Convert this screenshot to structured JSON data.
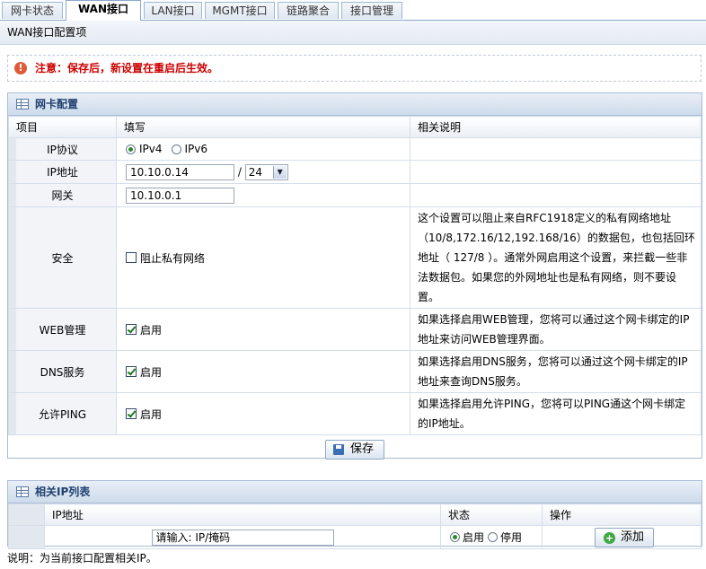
{
  "tabs": [
    {
      "label": "网卡状态",
      "active": false
    },
    {
      "label": "WAN接口",
      "active": true
    },
    {
      "label": "LAN接口",
      "active": false
    },
    {
      "label": "MGMT接口",
      "active": false
    },
    {
      "label": "链路聚合",
      "active": false
    },
    {
      "label": "接口管理",
      "active": false
    }
  ],
  "subheader": "WAN接口配置项",
  "notice": "注意：保存后，新设置在重启后生效。",
  "nic_panel": {
    "title": "网卡配置",
    "columns": [
      "项目",
      "填写",
      "相关说明"
    ],
    "ip_protocol": {
      "label": "IP协议",
      "options": [
        "IPv4",
        "IPv6"
      ],
      "selected": "IPv4"
    },
    "ip_address": {
      "label": "IP地址",
      "value": "10.10.0.14",
      "separator": "/",
      "mask": "24"
    },
    "gateway": {
      "label": "网关",
      "value": "10.10.0.1"
    },
    "security": {
      "label": "安全",
      "checkbox_label": "阻止私有网络",
      "checked": false,
      "desc": "这个设置可以阻止来自RFC1918定义的私有网络地址（10/8,172.16/12,192.168/16）的数据包，也包括回环地址（ 127/8 ）。通常外网启用这个设置，来拦截一些非法数据包。如果您的外网地址也是私有网络，则不要设置。"
    },
    "web_mgmt": {
      "label": "WEB管理",
      "checkbox_label": "启用",
      "checked": true,
      "desc": "如果选择启用WEB管理，您将可以通过这个网卡绑定的IP地址来访问WEB管理界面。"
    },
    "dns": {
      "label": "DNS服务",
      "checkbox_label": "启用",
      "checked": true,
      "desc": "如果选择启用DNS服务，您将可以通过这个网卡绑定的IP地址来查询DNS服务。"
    },
    "ping": {
      "label": "允许PING",
      "checkbox_label": "启用",
      "checked": true,
      "desc": "如果选择启用允许PING，您将可以PING通这个网卡绑定的IP地址。"
    },
    "save_label": "保存"
  },
  "ip_panel": {
    "title": "相关IP列表",
    "columns": [
      "IP地址",
      "状态",
      "操作"
    ],
    "input_placeholder": "请输入: IP/掩码",
    "status_options": [
      "启用",
      "停用"
    ],
    "status_selected": "启用",
    "add_label": "添加"
  },
  "footer": "说明：为当前接口配置相关IP。"
}
